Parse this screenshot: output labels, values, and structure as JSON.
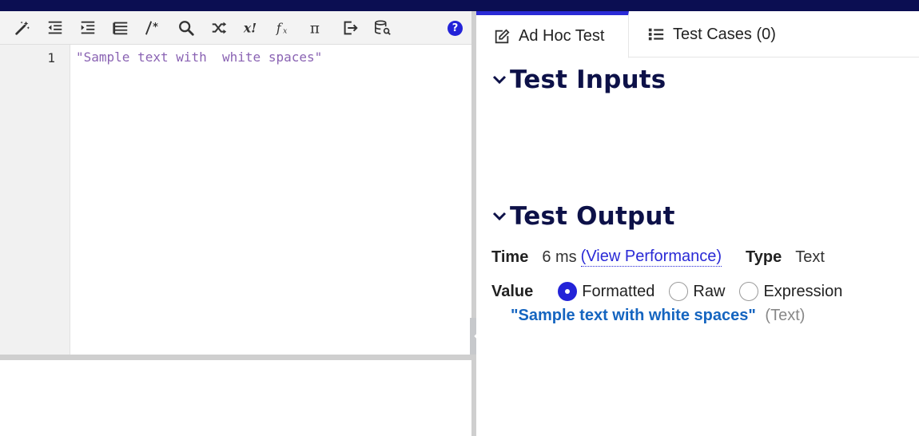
{
  "editor": {
    "line_number": "1",
    "code": "\"Sample text with  white spaces\""
  },
  "toolbar": {
    "buttons": [
      "magic-wand-icon",
      "outdent-icon",
      "indent-icon",
      "list-icon",
      "comment-icon",
      "search-icon",
      "shuffle-icon",
      "factorial-icon",
      "function-icon",
      "pi-icon",
      "export-icon",
      "database-search-icon"
    ],
    "help_label": "?"
  },
  "tabs": [
    {
      "label": "Ad Hoc Test",
      "icon": "edit-icon",
      "active": true
    },
    {
      "label": "Test Cases (0)",
      "icon": "list-icon",
      "active": false
    }
  ],
  "sections": {
    "inputs_title": "Test Inputs",
    "output_title": "Test Output"
  },
  "output": {
    "time_label": "Time",
    "time_value": "6 ms",
    "perf_link": "(View Performance)",
    "type_label": "Type",
    "type_value": "Text",
    "value_label": "Value",
    "formats": [
      {
        "label": "Formatted",
        "selected": true
      },
      {
        "label": "Raw",
        "selected": false
      },
      {
        "label": "Expression",
        "selected": false
      }
    ],
    "result_value": "\"Sample text with white spaces\"",
    "result_type": "(Text)"
  },
  "colors": {
    "accent": "#2323d8",
    "header_bar": "#0b0e52",
    "title": "#0d1148",
    "string_literal": "#8a63b3",
    "result": "#1565c0"
  }
}
